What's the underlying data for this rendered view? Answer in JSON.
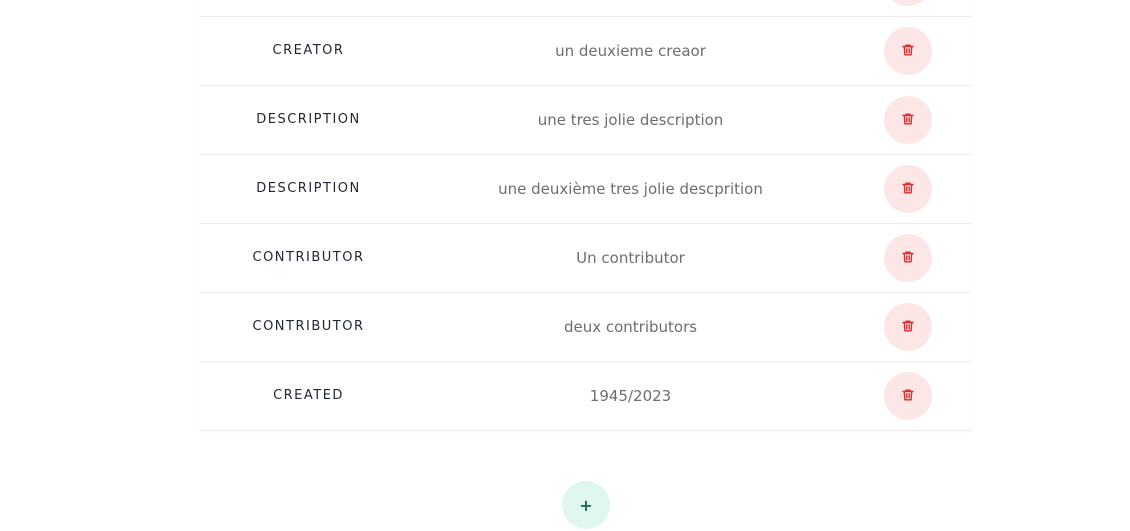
{
  "metadata_table": {
    "rows": [
      {
        "key": "",
        "value": ""
      },
      {
        "key": "CREATOR",
        "value": "un deuxieme creaor"
      },
      {
        "key": "DESCRIPTION",
        "value": "une tres jolie description"
      },
      {
        "key": "DESCRIPTION",
        "value": "une deuxième tres jolie descprition"
      },
      {
        "key": "CONTRIBUTOR",
        "value": "Un contributor"
      },
      {
        "key": "CONTRIBUTOR",
        "value": "deux contributors"
      },
      {
        "key": "CREATED",
        "value": "1945/2023"
      }
    ]
  },
  "delete_icon": "trash-icon",
  "add_button": {
    "label": "+"
  },
  "colors": {
    "delete_bg": "#fde6e6",
    "delete_icon": "#d32f2f",
    "add_bg": "#dff7ee",
    "add_fg": "#1c6b4c",
    "key_text": "#222831",
    "value_text": "#6e6e6e"
  }
}
